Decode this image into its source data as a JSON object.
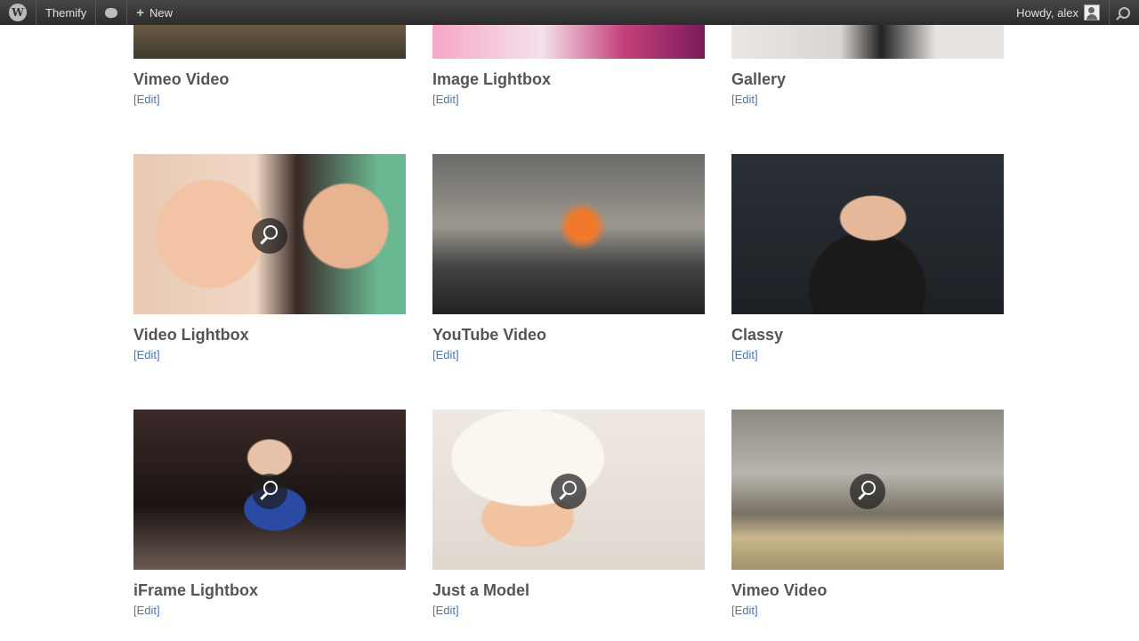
{
  "adminbar": {
    "site_name": "Themify",
    "new_label": "New",
    "greeting": "Howdy, alex"
  },
  "posts": [
    {
      "title": "Vimeo Video",
      "edit": "[Edit]"
    },
    {
      "title": "Image Lightbox",
      "edit": "[Edit]"
    },
    {
      "title": "Gallery",
      "edit": "[Edit]"
    },
    {
      "title": "Video Lightbox",
      "edit": "[Edit]"
    },
    {
      "title": "YouTube Video",
      "edit": "[Edit]"
    },
    {
      "title": "Classy",
      "edit": "[Edit]"
    },
    {
      "title": "iFrame Lightbox",
      "edit": "[Edit]"
    },
    {
      "title": "Just a Model",
      "edit": "[Edit]"
    },
    {
      "title": "Vimeo Video",
      "edit": "[Edit]"
    }
  ]
}
